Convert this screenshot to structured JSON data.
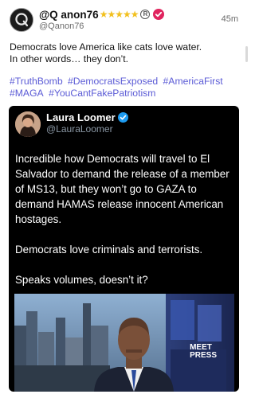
{
  "author": {
    "display_name": "@Q anon76",
    "stars": "★★★★★",
    "registered_mark": "R",
    "handle": "@Qanon76",
    "timestamp": "45m",
    "avatar_icon": "q-logo-icon"
  },
  "post": {
    "text_line1": "Democrats love America like cats love water.",
    "text_line2": "In other words… they don’t.",
    "hashtags": [
      "#TruthBomb",
      "#DemocratsExposed",
      "#AmericaFirst",
      "#MAGA",
      "#YouCantFakePatriotism"
    ]
  },
  "embedded": {
    "name": "Laura Loomer",
    "handle": "@LauraLoomer",
    "paragraphs": [
      "Incredible how Democrats will travel to El Salvador to demand the release of a member of MS13, but they won’t go to GAZA to demand HAMAS release innocent American hostages.",
      "Democrats love criminals and terrorists.",
      "Speaks volumes, doesn’t it?"
    ],
    "video_logo_line1": "MEET",
    "video_logo_line2": "PRESS"
  },
  "colors": {
    "hashtag": "#5b5bd6",
    "verified": "#e0245e",
    "embed_verified": "#1d9bf0",
    "stars": "#f2c01e"
  }
}
